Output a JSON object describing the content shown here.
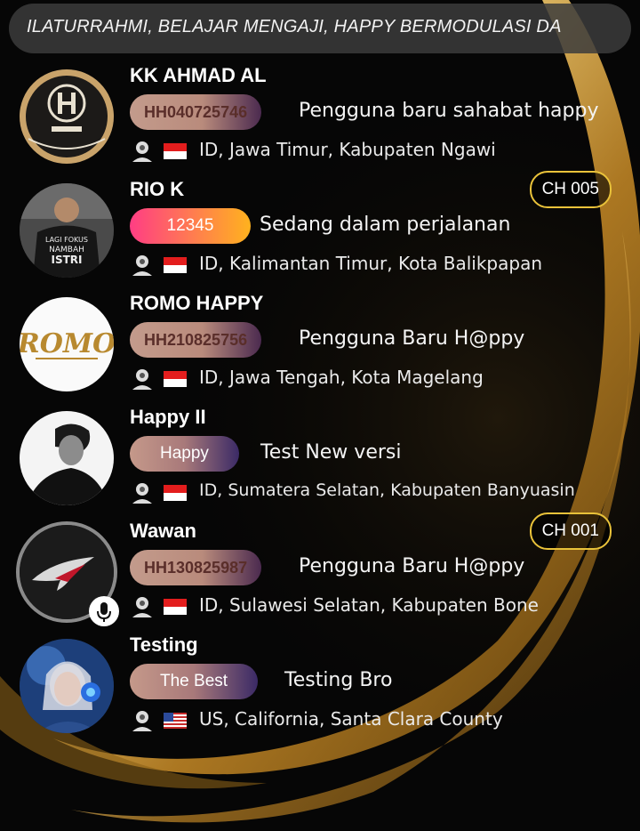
{
  "marquee": {
    "text": "ILATURRAHMI, BELAJAR MENGAJI, HAPPY BERMODULASI DA"
  },
  "users": [
    {
      "name": "KK AHMAD AL",
      "tag": "HH040725746",
      "tag_style": "id",
      "status": "Pengguna baru sahabat happy",
      "country": "ID",
      "location": "ID, Jawa Timur, Kabupaten Ngawi",
      "avatar": "ch010-logo-avatar"
    },
    {
      "name": "RIO K",
      "tag": "12345",
      "tag_style": "orange",
      "status": "Sedang dalam perjalanan",
      "country": "ID",
      "location": "ID, Kalimantan Timur, Kota Balikpapan",
      "channel": "CH 005",
      "avatar": "man-shirt-avatar"
    },
    {
      "name": "ROMO HAPPY",
      "tag": "HH210825756",
      "tag_style": "id",
      "status": "Pengguna Baru H@ppy",
      "country": "ID",
      "location": "ID, Jawa Tengah, Kota Magelang",
      "avatar": "romo-logo-avatar"
    },
    {
      "name": "Happy II",
      "tag": "Happy",
      "tag_style": "plain",
      "status": "Test New versi",
      "country": "ID",
      "location": "ID, Sumatera Selatan, Kabupaten Banyuasin",
      "avatar": "man-bw-avatar"
    },
    {
      "name": "Wawan",
      "tag": "HH130825987",
      "tag_style": "id",
      "status": "Pengguna Baru H@ppy",
      "country": "ID",
      "location": "ID, Sulawesi Selatan, Kabupaten Bone",
      "channel": "CH 001",
      "avatar": "rog-logo-avatar",
      "mic": true
    },
    {
      "name": "Testing",
      "tag": "The Best",
      "tag_style": "plain",
      "status": "Testing Bro",
      "country": "US",
      "location": "US, California, Santa Clara County",
      "avatar": "woman-headphones-avatar"
    }
  ],
  "colors": {
    "gold": "#d4a23a",
    "badge_border": "#e9c23a"
  }
}
